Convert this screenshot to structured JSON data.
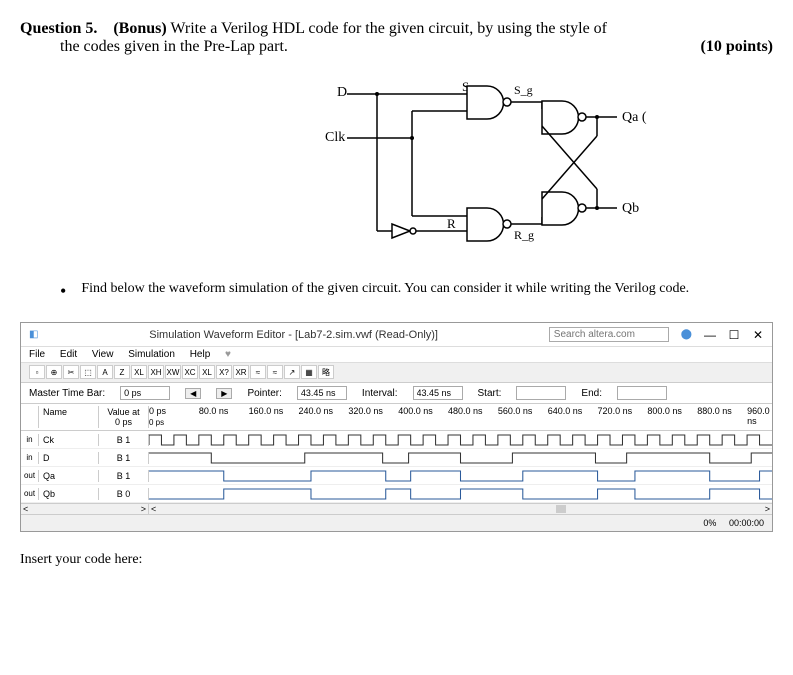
{
  "question": {
    "number": "Question 5.",
    "bonus": "(Bonus)",
    "text": "Write a Verilog HDL code for the given circuit, by using the style of",
    "text2": "the codes given in the Pre-Lap part.",
    "points": "(10 points)"
  },
  "circuit": {
    "labels": {
      "D": "D",
      "Clk": "Clk",
      "S": "S",
      "R": "R",
      "S_g": "S_g",
      "R_g": "R_g",
      "Qa": "Qa (Q)",
      "Qb": "Qb"
    }
  },
  "bullet": {
    "text": "Find below the waveform simulation of the given circuit. You can consider it while writing the Verilog code."
  },
  "sim": {
    "title": "Simulation Waveform Editor - [Lab7-2.sim.vwf (Read-Only)]",
    "search_placeholder": "Search altera.com",
    "menu": [
      "File",
      "Edit",
      "View",
      "Simulation",
      "Help"
    ],
    "params": {
      "master_time_bar_label": "Master Time Bar:",
      "master_time_bar_value": "0 ps",
      "pointer_label": "Pointer:",
      "pointer_value": "43.45 ns",
      "interval_label": "Interval:",
      "interval_value": "43.45 ns",
      "start_label": "Start:",
      "start_value": "",
      "end_label": "End:",
      "end_value": ""
    },
    "headers": {
      "name": "Name",
      "value_at": "Value at",
      "value_at_time": "0 ps"
    },
    "time_marks": [
      "0 ps",
      "80.0 ns",
      "160.0 ns",
      "240.0 ns",
      "320.0 ns",
      "400.0 ns",
      "480.0 ns",
      "560.0 ns",
      "640.0 ns",
      "720.0 ns",
      "800.0 ns",
      "880.0 ns",
      "960.0 ns"
    ],
    "time_sub": "0 ps",
    "signals": [
      {
        "icon": "in",
        "name": "Ck",
        "value": "B 1"
      },
      {
        "icon": "in",
        "name": "D",
        "value": "B 1"
      },
      {
        "icon": "out",
        "name": "Qa",
        "value": "B 1"
      },
      {
        "icon": "out",
        "name": "Qb",
        "value": "B 0"
      }
    ],
    "status": {
      "percent": "0%",
      "time": "00:00:00"
    }
  },
  "insert": "Insert your code here:"
}
